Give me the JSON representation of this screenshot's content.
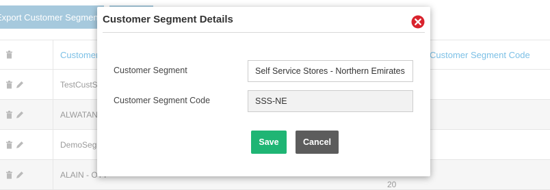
{
  "toolbar": {
    "export_label": "Export Customer Segments"
  },
  "grid": {
    "header_name": "Customer Segment",
    "header_code": "Customer Segment Code",
    "rows": [
      {
        "name": "TestCustSegment",
        "code": ""
      },
      {
        "name": "ALWATANIA",
        "code": ""
      },
      {
        "name": "DemoSegment",
        "code": ""
      },
      {
        "name": "ALAIN - OTT",
        "code": "20"
      }
    ]
  },
  "modal": {
    "title": "Customer Segment Details",
    "segment_label": "Customer Segment",
    "segment_value": "Self Service Stores - Northern Emirates",
    "code_label": "Customer Segment Code",
    "code_value": "SSS-NE",
    "save_label": "Save",
    "cancel_label": "Cancel"
  },
  "colors": {
    "save": "#1fb574",
    "cancel": "#5c5c5c",
    "close": "#d9232d",
    "toolbar_button": "#a6c9dd",
    "header_text": "#7cc0e6"
  },
  "icons": [
    "trash-icon",
    "pencil-icon",
    "close-icon"
  ]
}
